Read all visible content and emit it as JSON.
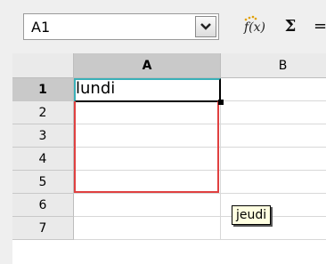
{
  "toolbar": {
    "name_box_value": "A1",
    "function_wizard_label": "f(x)",
    "sum_label": "Σ",
    "equals_label": "="
  },
  "grid": {
    "columns": [
      {
        "label": "A",
        "selected": true
      },
      {
        "label": "B",
        "selected": false
      }
    ],
    "rows": [
      {
        "label": "1",
        "selected": true
      },
      {
        "label": "2",
        "selected": false
      },
      {
        "label": "3",
        "selected": false
      },
      {
        "label": "4",
        "selected": false
      },
      {
        "label": "5",
        "selected": false
      },
      {
        "label": "6",
        "selected": false
      },
      {
        "label": "7",
        "selected": false
      }
    ],
    "cells": {
      "A1": "lundi"
    }
  },
  "autofill_tooltip": "jeudi",
  "colors": {
    "cursor_border": "#3ab0b8",
    "autofill_border": "#e04040",
    "header_selected": "#c9c9c9",
    "header_normal": "#eaeaea"
  }
}
